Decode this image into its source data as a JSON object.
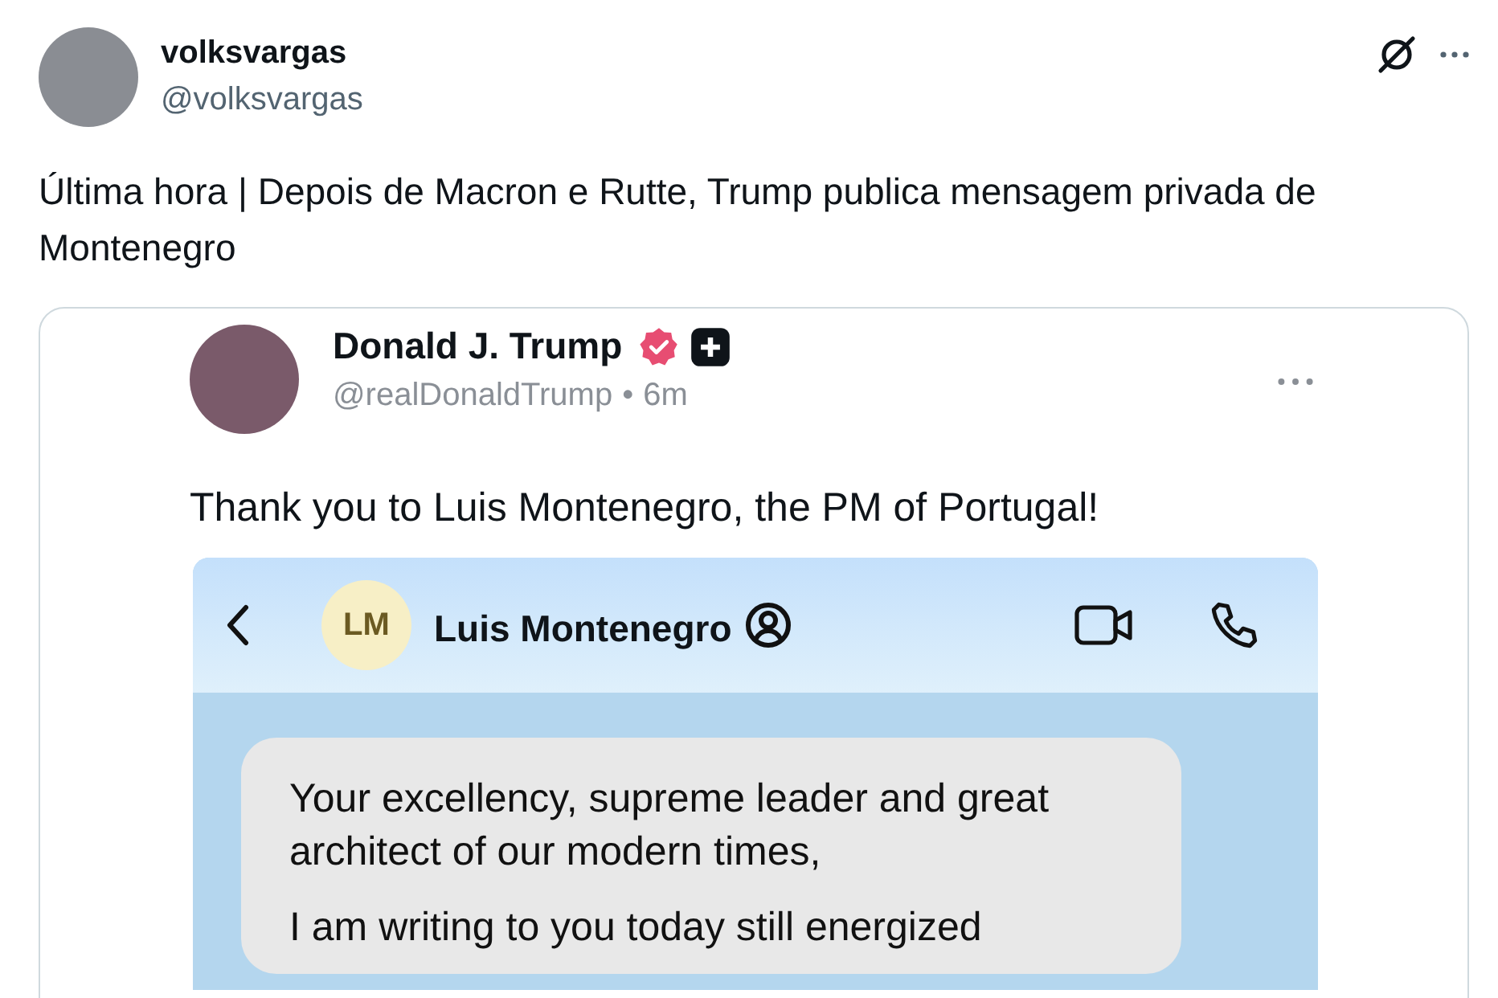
{
  "post": {
    "author": {
      "name": "volksvargas",
      "handle": "@volksvargas"
    },
    "text": "Última hora | Depois de Macron e Rutte, Trump publica mensagem privada de Montenegro",
    "quoted": {
      "author": {
        "name": "Donald J. Trump",
        "verified": true,
        "handle": "@realDonaldTrump",
        "separator": "•",
        "time": "6m"
      },
      "text": "Thank you to Luis Montenegro, the PM of Portugal!",
      "screenshot": {
        "contact": {
          "initials": "LM",
          "name": "Luis Montenegro"
        },
        "paragraphs": [
          "Your excellency, supreme leader and great architect of our modern times,",
          "I am writing to you today still energized"
        ]
      }
    }
  }
}
